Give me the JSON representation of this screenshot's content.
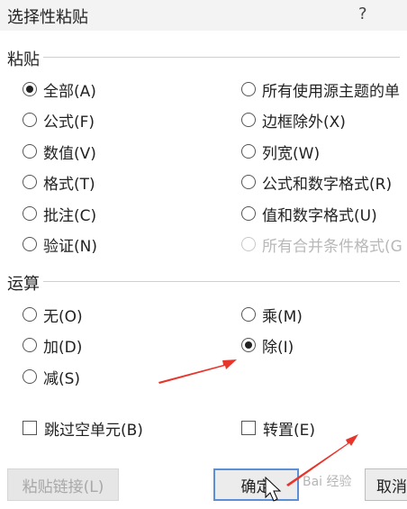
{
  "dialog": {
    "title": "选择性粘贴",
    "help": "?"
  },
  "paste": {
    "label": "粘贴",
    "left_options": [
      {
        "label": "全部(A)",
        "checked": true
      },
      {
        "label": "公式(F)",
        "checked": false
      },
      {
        "label": "数值(V)",
        "checked": false
      },
      {
        "label": "格式(T)",
        "checked": false
      },
      {
        "label": "批注(C)",
        "checked": false
      },
      {
        "label": "验证(N)",
        "checked": false
      }
    ],
    "right_options": [
      {
        "label": "所有使用源主题的单",
        "checked": false,
        "disabled": false
      },
      {
        "label": "边框除外(X)",
        "checked": false,
        "disabled": false
      },
      {
        "label": "列宽(W)",
        "checked": false,
        "disabled": false
      },
      {
        "label": "公式和数字格式(R)",
        "checked": false,
        "disabled": false
      },
      {
        "label": "值和数字格式(U)",
        "checked": false,
        "disabled": false
      },
      {
        "label": "所有合并条件格式(G",
        "checked": false,
        "disabled": true
      }
    ]
  },
  "operation": {
    "label": "运算",
    "left_options": [
      {
        "label": "无(O)",
        "checked": false
      },
      {
        "label": "加(D)",
        "checked": false
      },
      {
        "label": "减(S)",
        "checked": false
      }
    ],
    "right_options": [
      {
        "label": "乘(M)",
        "checked": false
      },
      {
        "label": "除(I)",
        "checked": true
      }
    ]
  },
  "checkboxes": {
    "skip_blanks": "跳过空单元(B)",
    "transpose": "转置(E)"
  },
  "buttons": {
    "paste_link": "粘贴链接(L)",
    "ok": "确定",
    "cancel": "取消"
  },
  "watermark": "Bai 经验",
  "colors": {
    "annotation_arrow": "#e8352b",
    "ok_border": "#5b8fd6"
  }
}
